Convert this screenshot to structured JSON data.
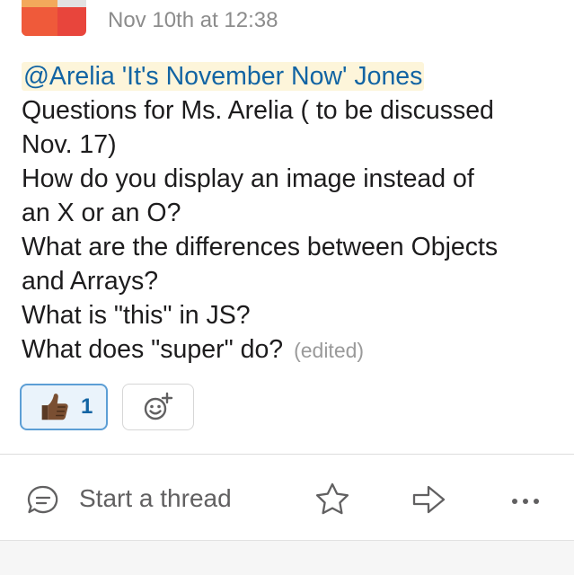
{
  "message": {
    "timestamp": "Nov 10th at 12:38",
    "mention": "@Arelia 'It's November Now' Jones",
    "lines": [
      "Questions for Ms. Arelia ( to be discussed",
      "Nov. 17)",
      "How do you display an image instead of",
      "an X or an O?",
      "What are the differences between Objects",
      "and Arrays?",
      "What is \"this\" in JS?",
      "What does \"super\" do?"
    ],
    "edited_label": "(edited)"
  },
  "reactions": [
    {
      "icon": "thumbs-up-icon",
      "count": "1"
    },
    {
      "icon": "add-reaction-icon"
    }
  ],
  "actions": {
    "thread_label": "Start a thread",
    "icons": [
      "thread-bubble-icon",
      "star-icon",
      "share-icon",
      "more-icon"
    ]
  },
  "colors": {
    "mention_text": "#1264a3",
    "mention_bg": "#fdf5da",
    "reaction_border": "#5c9ed5",
    "reaction_bg": "#eaf3fb",
    "muted_text": "#8c8c8c"
  }
}
